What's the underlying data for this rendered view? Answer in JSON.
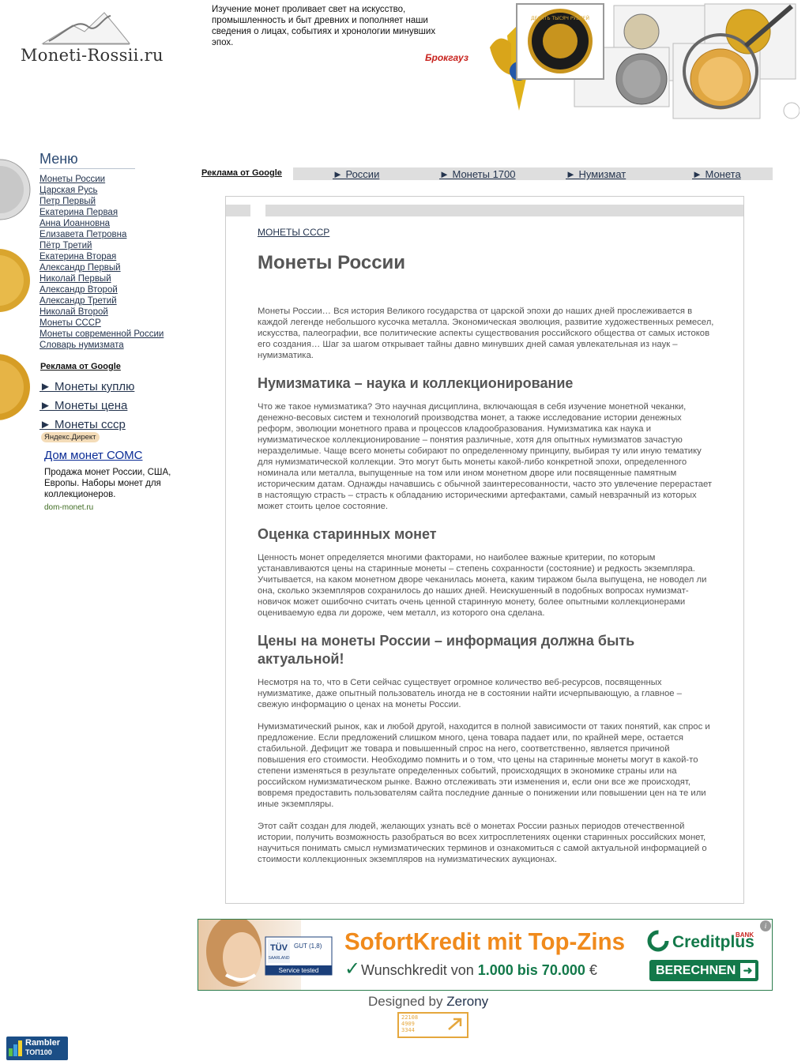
{
  "header": {
    "logo_text": "Moneti-Rossii.ru",
    "quote": "Изучение монет проливает свет на искусство, промышленность и быт древних и пополняет наши сведения о лицах, событиях и хронологии минувших эпох.",
    "quote_author": "Брокгауз",
    "coin_text": "ДЕСЯТЬ ТЫСЯЧ РУБЛЕЙ"
  },
  "menu": {
    "title": "Меню",
    "items": [
      "Монеты России",
      "Царская Русь",
      "Петр Первый",
      "Екатерина Первая",
      "Анна Иоанновна",
      "Елизавета Петровна",
      "Пётр Третий",
      "Екатерина Вторая",
      "Александр Первый",
      "Николай Первый",
      "Александр Второй",
      "Александр Третий",
      "Николай Второй",
      "Монеты СССР",
      "Монеты современной России",
      "Словарь нумизмата"
    ]
  },
  "left_ads": {
    "title": "Реклама от Google",
    "links": [
      "► Монеты куплю",
      "► Монеты цена",
      "► Монеты ссср"
    ],
    "yandex_label": "Яндекс.Директ",
    "somc_title": "Дом монет СОМС",
    "somc_text": "Продажа монет России, США, Европы. Наборы монет для коллекционеров.",
    "somc_url": "dom-monet.ru"
  },
  "top_ads": {
    "label": "Реклама от Google",
    "links": [
      "► России",
      "► Монеты 1700",
      "► Нумизмат",
      "► Монета"
    ]
  },
  "content": {
    "breadcrumb": "МОНЕТЫ СССР",
    "title": "Монеты России",
    "intro": "Монеты России… Вся история Великого государства от царской эпохи до наших дней прослеживается в каждой легенде небольшого кусочка металла. Экономическая эволюция, развитие художественных ремесел, искусства, палеографии, все политические аспекты существования российского общества от самых истоков его создания… Шаг за шагом открывает тайны давно минувших дней самая увлекательная из наук – нумизматика.",
    "h_numismatics": "Нумизматика – наука и коллекционирование",
    "p_numismatics": "Что же такое нумизматика? Это научная дисциплина, включающая в себя изучение монетной чеканки, денежно-весовых систем и технологий производства монет, а также исследование истории денежных реформ, эволюции монетного права и процессов кладообразования. Нумизматика как наука и нумизматическое коллекционирование – понятия различные, хотя для опытных нумизматов зачастую неразделимые. Чаще всего монеты собирают по определенному принципу, выбирая ту или иную тематику для нумизматической коллекции. Это могут быть монеты какой-либо конкретной эпохи, определенного номинала или металла, выпущенные на том или ином монетном дворе или посвященные памятным историческим датам. Однажды начавшись с обычной заинтересованности, часто это увлечение перерастает в настоящую страсть – страсть к обладанию историческими артефактами, самый невзрачный из которых может стоить целое состояние.",
    "h_valuation": "Оценка старинных монет",
    "p_valuation": "Ценность монет определяется многими факторами, но наиболее важные критерии, по которым устанавливаются цены на старинные монеты – степень сохранности (состояние) и редкость экземпляра. Учитывается, на каком монетном дворе чеканилась монета, каким тиражом была выпущена, не новодел ли она, сколько экземпляров сохранилось до наших дней. Неискушенный в подобных вопросах нумизмат-новичок может ошибочно считать очень ценной старинную монету, более опытными коллекционерами оцениваемую едва ли дороже, чем металл, из которого она сделана.",
    "h_prices": "Цены на монеты России – информация должна быть актуальной!",
    "p_prices_1": "Несмотря на то, что в Сети сейчас существует огромное количество веб-ресурсов, посвященных нумизматике, даже опытный пользователь иногда не в состоянии найти исчерпывающую, а главное – свежую информацию о ценах на монеты России.",
    "p_prices_2": "Нумизматический рынок, как и любой другой, находится в полной зависимости от таких понятий, как спрос и предложение. Если предложений слишком много, цена товара падает или, по крайней мере, остается стабильной. Дефицит же товара и повышенный спрос на него, соответственно, является причиной повышения его стоимости. Необходимо помнить и о том, что цены на старинные монеты могут в какой-то степени изменяться в результате определенных событий, происходящих в экономике страны или на российском нумизматическом рынке. Важно отслеживать эти изменения и, если они все же происходят, вовремя предоставить пользователям сайта последние данные о понижении или повышении цен на те или иные экземпляры.",
    "p_prices_3": "Этот сайт создан для людей, желающих узнать всё о монетах России разных периодов отечественной истории, получить возможность разобраться во всех хитросплетениях оценки старинных российских монет, научиться понимать смысл нумизматических терминов и ознакомиться с самой актуальной информацией о стоимости коллекционных экземпляров на нумизматических аукционах."
  },
  "banner": {
    "tuv_line1": "TÜV",
    "tuv_line2": "SAARLAND",
    "tuv_grade": "GUT (1,8)",
    "tuv_service": "Service tested",
    "headline": "SofortKredit mit Top-Zins",
    "sub_prefix": "Wunschkredit von",
    "sub_amount": "1.000 bis 70.000",
    "sub_suffix": "€",
    "brand": "Creditplus",
    "brand_sup": "BANK",
    "button": "BERECHNEN",
    "info": "i"
  },
  "footer": {
    "designed_prefix": "Designed by",
    "designed_name": "Zerony",
    "counter_lines": [
      "22108",
      "4909",
      "3344"
    ],
    "rambler_line1": "Rambler",
    "rambler_line2": "ТОП100"
  },
  "colors": {
    "link": "#24344e",
    "text": "#555555",
    "banner_orange": "#f08a1c",
    "banner_green": "#13794a",
    "author_red": "#c8231e"
  }
}
